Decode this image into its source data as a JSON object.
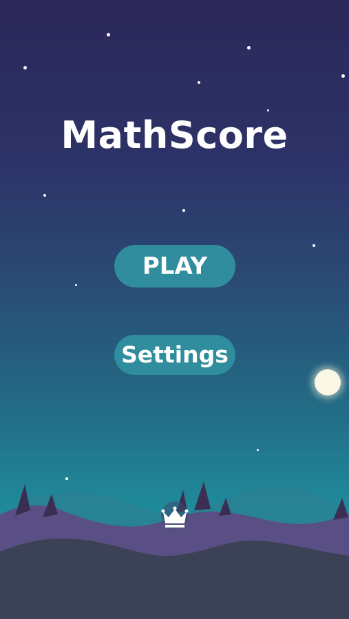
{
  "game": {
    "title": "MathScore"
  },
  "menu": {
    "play_label": "PLAY",
    "settings_label": "Settings"
  },
  "leaderboard": {
    "icon": "crown-icon"
  },
  "colors": {
    "sky_top": "#2c2859",
    "sky_bottom": "#1d95a4",
    "button": "#2f8d9e",
    "text": "#ffffff",
    "hills_back": "#5a4f84",
    "hills_front": "#3b4256",
    "moon": "#fbf7e6"
  }
}
